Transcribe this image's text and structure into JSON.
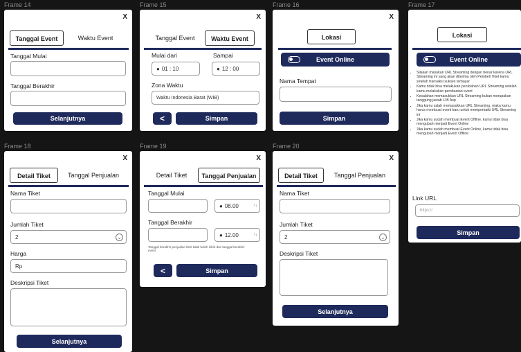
{
  "frames": {
    "f14": {
      "label": "Frame 14",
      "close": "X",
      "tab_active": "Tanggal Event",
      "tab_inactive": "Waktu Event",
      "start_label": "Tanggal Mulai",
      "end_label": "Tanggal Berakhir",
      "button": "Selanjutnya"
    },
    "f15": {
      "label": "Frame 15",
      "close": "X",
      "tab_inactive": "Tanggal Event",
      "tab_active": "Waktu Event",
      "from_label": "Mulai dari",
      "to_label": "Sampai",
      "from_value": "01 : 10",
      "to_value": "12 : 00",
      "zone_label": "Zona Waktu",
      "zone_value": "Waktu Indonesia Barat (WIB)",
      "back": "<",
      "button": "Simpan"
    },
    "f16": {
      "label": "Frame 16",
      "close": "X",
      "location_tab": "Lokasi",
      "online_label": "Event Online",
      "place_label": "Nama Tempat",
      "button": "Simpan"
    },
    "f17": {
      "label": "Frame 17",
      "location_tab": "Lokasi",
      "online_label": "Event Online",
      "bullets": [
        "Silakan masukan URL Streaming dengan benar karena URL Streaming ini yang akan diterima oleh Pembeli Tiket kamu setelah transaksi sukses terbayar",
        "Kamu tidak bisa melakukan perubahan URL Streaming setelah kamu melakukan pembuatan event",
        "Kesalahan memasukkan URL Streaming bukan merupakan tanggung jawab U.B Asp",
        "Jika kamu salah memasukkan URL Streaming, maka kamu harus membuat event baru untuk memperbaiki URL Streaming ini",
        "Jika kamu sudah membuat Event Offline, kamu tidak bisa mengubah menjadi Event Online",
        "Jika kamu sudah membuat Event Online, kamu tidak bisa mengubah menjadi Event Offline"
      ],
      "link_label": "Link URL",
      "link_placeholder": "https://",
      "button": "Simpan"
    },
    "f18": {
      "label": "Frame 18",
      "close": "X",
      "tab_active": "Detail Tiket",
      "tab_inactive": "Tanggal Penjualan",
      "name_label": "Nama Tiket",
      "qty_label": "Jumlah Tiket",
      "qty_value": "2",
      "price_label": "Harga",
      "price_value": "Rp",
      "desc_label": "Deskripsi Tiket",
      "button": "Selanjutnya"
    },
    "f19": {
      "label": "Frame 19",
      "close": "X",
      "tab_inactive": "Detail Tiket",
      "tab_active": "Tanggal Penjualan",
      "start_label": "Tanggal Mulai",
      "start_time": "08.00",
      "end_label": "Tanggal Berakhir",
      "end_time": "12.00",
      "note": "Tanggal berakhir penjualan tiket tidak boleh lebih dari tanggal berakhir event",
      "back": "<",
      "button": "Simpan"
    },
    "f20": {
      "label": "Frame 20",
      "close": "X",
      "tab_active": "Detail Tiket",
      "tab_inactive": "Tanggal Penjualan",
      "name_label": "Nama Tiket",
      "qty_label": "Jumlah Tiket",
      "qty_value": "2",
      "desc_label": "Deskripsi Tiket",
      "button": "Selanjutnya"
    }
  },
  "colors": {
    "primary": "#1f2a5c",
    "background": "#151515",
    "card": "#ffffff"
  }
}
